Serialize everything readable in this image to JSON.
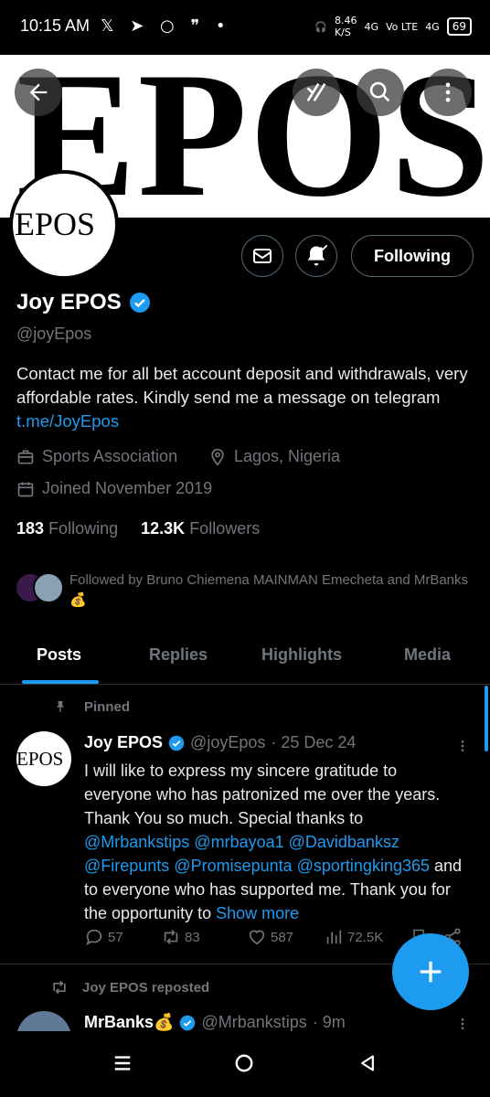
{
  "status_bar": {
    "time": "10:15 AM",
    "speed": "8.46",
    "speed_unit": "K/S",
    "net1": "4G",
    "volte": "Vo LTE",
    "net2": "4G",
    "battery": "69"
  },
  "banner": {
    "text": "EPOS"
  },
  "avatar": {
    "text": "EPOS"
  },
  "header_actions": {
    "follow_label": "Following"
  },
  "profile": {
    "name": "Joy EPOS",
    "handle": "@joyEpos",
    "bio_text": "Contact me for all bet account deposit and withdrawals, very affordable rates. Kindly send me a message on telegram ",
    "bio_link": "t.me/JoyEpos",
    "category": "Sports Association",
    "location": "Lagos, Nigeria",
    "joined": "Joined November 2019",
    "following_count": "183",
    "following_label": "Following",
    "followers_count": "12.3K",
    "followers_label": "Followers",
    "followed_by": "Followed by Bruno Chiemena MAINMAN Emecheta and MrBanks💰"
  },
  "tabs": [
    {
      "label": "Posts",
      "active": true
    },
    {
      "label": "Replies"
    },
    {
      "label": "Highlights"
    },
    {
      "label": "Media"
    }
  ],
  "post1": {
    "pinned_label": "Pinned",
    "avatar_text": "EPOS",
    "name": "Joy EPOS",
    "handle": "@joyEpos",
    "date": "· 25 Dec 24",
    "text_1": "I will like to express my sincere gratitude to everyone who has patronized me over the years. Thank You so much. Special thanks to ",
    "mentions": "@Mrbankstips @mrbayoa1 @Davidbanksz @Firepunts @Promisepunta @sportingking365",
    "text_2": " and to everyone who has supported me. Thank you for the opportunity to ",
    "show_more": "Show more",
    "replies": "57",
    "reposts": "83",
    "likes": "587",
    "views": "72.5K"
  },
  "post2": {
    "repost_label": "Joy EPOS reposted",
    "name": "MrBanks💰",
    "handle": "@Mrbankstips",
    "time": "· 9m"
  },
  "colors": {
    "accent": "#1d9bf0",
    "muted": "#71767b",
    "bg": "#000000"
  }
}
